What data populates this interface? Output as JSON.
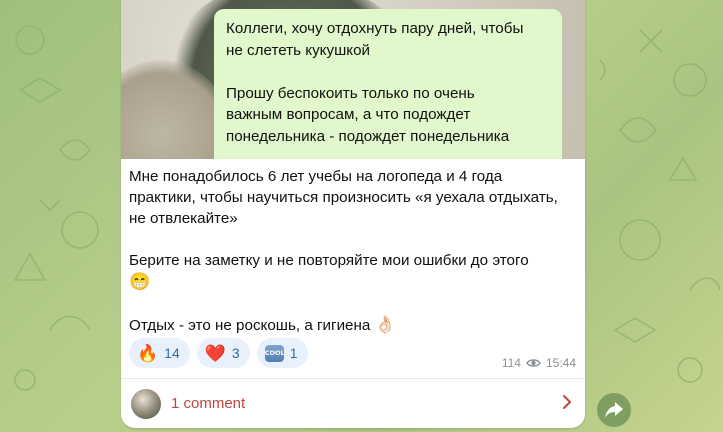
{
  "post": {
    "quote": {
      "paragraph1": "Коллеги, хочу отдохнуть пару дней, чтобы\nне слететь кукушкой",
      "paragraph2": "Прошу беспокоить только по очень\nважным вопросам, а что подождет\nпонедельника - подождет понедельника"
    },
    "message": {
      "paragraph1": "Мне понадобилось 6 лет учебы на логопеда и 4 года практики, чтобы научиться произносить «я уехала отдыхать, не отвлекайте»",
      "paragraph2": "Берите на заметку и не повторяйте мои ошибки до этого",
      "paragraph2_emoji": "😁",
      "paragraph3": "Отдых - это не роскошь, а гигиена",
      "paragraph3_emoji": "👌🏻"
    },
    "reactions": [
      {
        "emoji": "🔥",
        "count": "14"
      },
      {
        "emoji": "❤️",
        "count": "3"
      },
      {
        "emoji": "COOL",
        "count": "1"
      }
    ],
    "views": "114",
    "time": "15:44",
    "comments_label": "1 comment"
  },
  "icons": {
    "views": "eye-icon",
    "comments_arrow": "chevron-right-icon",
    "share": "share-arrow-icon"
  },
  "colors": {
    "background": "#a9c482",
    "quote_bubble": "#e1f8cc",
    "reaction_bg": "#e8f1fb",
    "reaction_text": "#2f6ea5",
    "comment_link": "#c0453e",
    "meta_text": "#8a8f94"
  }
}
